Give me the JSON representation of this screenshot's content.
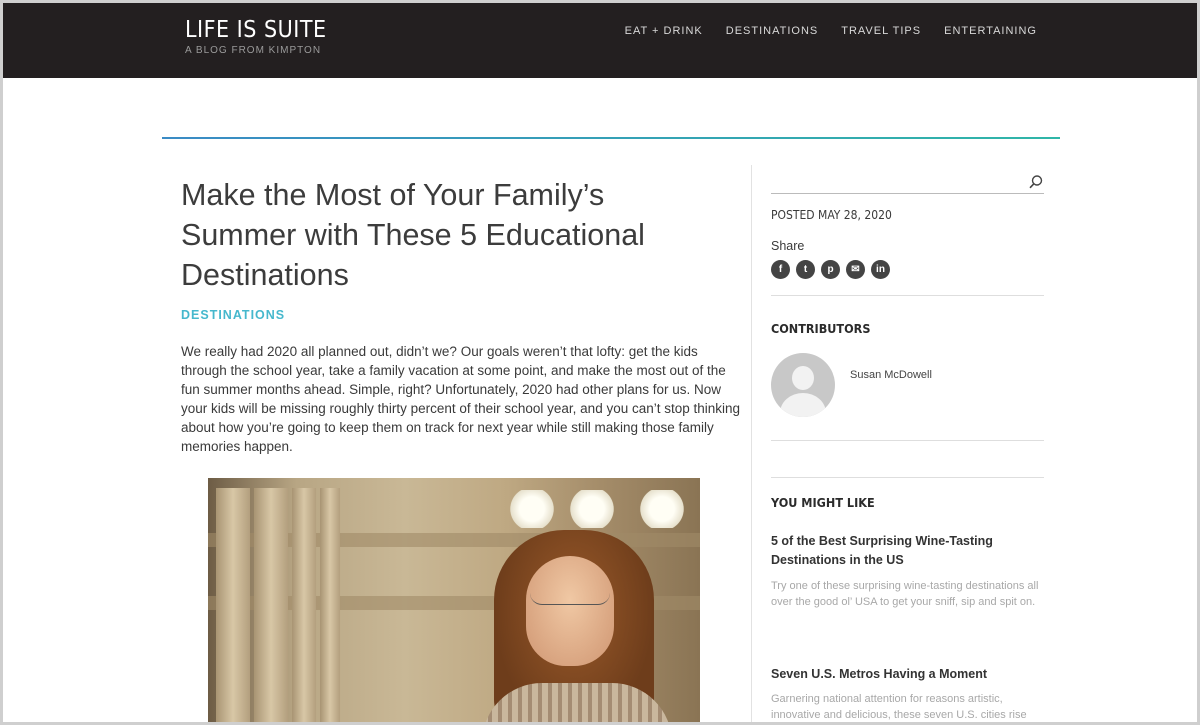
{
  "header": {
    "brand_title": "LIFE IS SUITE",
    "brand_subtitle": "A BLOG FROM KIMPTON",
    "nav": [
      "EAT + DRINK",
      "DESTINATIONS",
      "TRAVEL TIPS",
      "ENTERTAINING"
    ]
  },
  "article": {
    "title": "Make the Most of Your Family’s Summer with These 5 Educational Destinations",
    "category": "DESTINATIONS",
    "body": "We really had 2020 all planned out, didn’t we? Our goals weren’t that lofty: get the kids through the school year, take a family vacation at some point, and make the most out of the fun summer months ahead. Simple, right? Unfortunately, 2020 had other plans for us. Now your kids will be missing roughly thirty percent of their school year, and you can’t stop thinking about how you’re going to keep them on track for next year while still making those family memories happen."
  },
  "sidebar": {
    "search_placeholder": "",
    "posted": "POSTED MAY 28, 2020",
    "share_label": "Share",
    "share_icons": [
      "facebook-icon",
      "twitter-icon",
      "pinterest-icon",
      "email-icon",
      "linkedin-icon"
    ],
    "contributors_heading": "CONTRIBUTORS",
    "contributor_name": "Susan McDowell",
    "you_might_like_heading": "YOU MIGHT LIKE",
    "related": [
      {
        "title": "5 of the Best Surprising Wine-Tasting Destinations in the US",
        "desc": "Try one of these surprising wine-tasting destinations all over the good ol’ USA to get your sniff, sip and spit on."
      },
      {
        "title": "Seven U.S. Metros Having a Moment",
        "desc": "Garnering national attention for reasons artistic, innovative and delicious, these seven U.S. cities rise"
      }
    ]
  },
  "colors": {
    "header_bg": "#231f20",
    "accent_teal": "#46b8cd",
    "rule_gradient_start": "#3a8bc5",
    "rule_gradient_end": "#2fb6a8"
  }
}
